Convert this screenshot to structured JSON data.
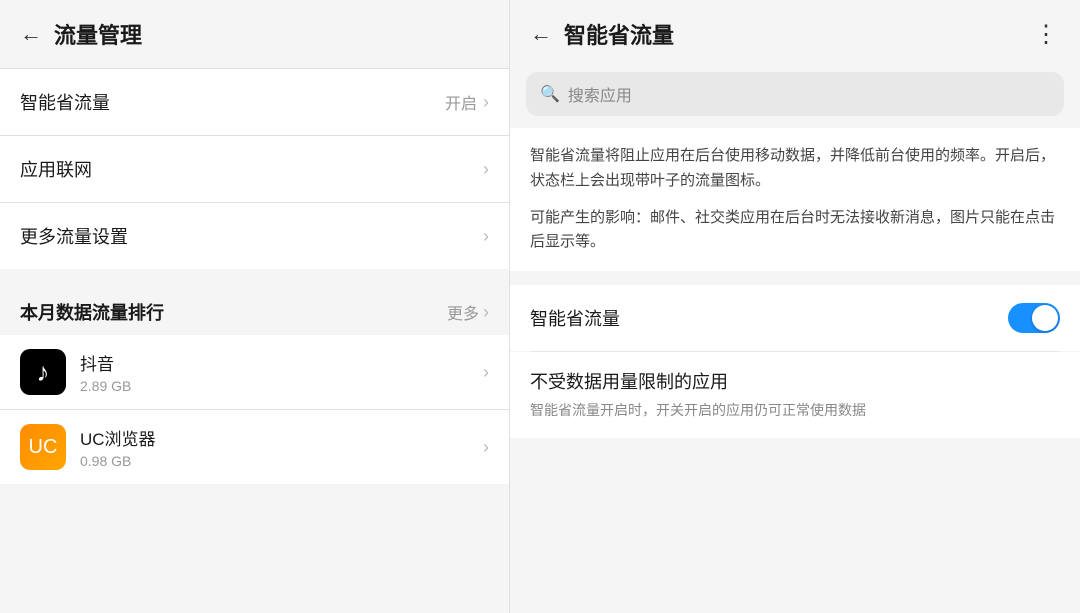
{
  "left": {
    "header": {
      "back_label": "←",
      "title": "流量管理"
    },
    "menu_items": [
      {
        "label": "智能省流量",
        "value": "开启",
        "has_value": true
      },
      {
        "label": "应用联网",
        "value": "",
        "has_value": false
      },
      {
        "label": "更多流量设置",
        "value": "",
        "has_value": false
      }
    ],
    "section": {
      "title": "本月数据流量排行",
      "more_label": "更多"
    },
    "apps": [
      {
        "name": "抖音",
        "size": "2.89 GB",
        "icon_type": "douyin"
      },
      {
        "name": "UC浏览器",
        "size": "0.98 GB",
        "icon_type": "uc"
      }
    ],
    "chevron": "›"
  },
  "right": {
    "header": {
      "back_label": "←",
      "title": "智能省流量",
      "more_icon": "⋮"
    },
    "search": {
      "placeholder": "搜索应用",
      "icon": "🔍"
    },
    "descriptions": [
      "智能省流量将阻止应用在后台使用移动数据，并降低前台使用的频率。开启后，状态栏上会出现带叶子的流量图标。",
      "可能产生的影响：邮件、社交类应用在后台时无法接收新消息，图片只能在点击后显示等。"
    ],
    "toggle": {
      "label": "智能省流量",
      "enabled": true
    },
    "unrestricted": {
      "title": "不受数据用量限制的应用",
      "description": "智能省流量开启时，开关开启的应用仍可正常使用数据"
    }
  }
}
